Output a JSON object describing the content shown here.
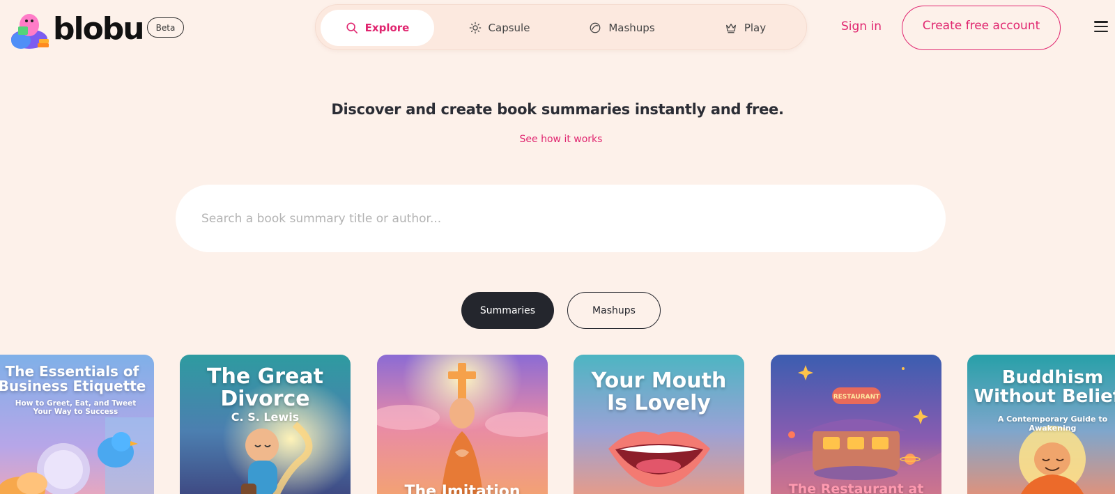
{
  "brand": {
    "name": "blobu",
    "badge": "Beta"
  },
  "nav": {
    "items": [
      {
        "label": "Explore",
        "icon": "search-icon",
        "active": true
      },
      {
        "label": "Capsule",
        "icon": "sun-icon",
        "active": false
      },
      {
        "label": "Mashups",
        "icon": "blend-icon",
        "active": false
      },
      {
        "label": "Play",
        "icon": "crown-icon",
        "active": false
      }
    ]
  },
  "header": {
    "signin": "Sign in",
    "create_account": "Create free account"
  },
  "hero": {
    "headline": "Discover and create book summaries instantly and free.",
    "how_link": "See how it works"
  },
  "search": {
    "placeholder": "Search a book summary title or author...",
    "value": ""
  },
  "filters": {
    "summaries": "Summaries",
    "mashups": "Mashups",
    "active": "Summaries"
  },
  "books": [
    {
      "title": "The Essentials of Business Etiquette",
      "subtitle": "How to Greet, Eat, and Tweet Your Way to Success"
    },
    {
      "title": "The Great Divorce",
      "author": "C. S. Lewis"
    },
    {
      "title": "The Imitation"
    },
    {
      "title": "Your Mouth Is Lovely"
    },
    {
      "title": "The Restaurant at",
      "sign": "RESTAURANT"
    },
    {
      "title": "Buddhism Without Beliefs",
      "subtitle": "A Contemporary Guide to Awakening"
    }
  ],
  "colors": {
    "accent": "#e0256f",
    "background": "#fdf1ea",
    "dark": "#24262d"
  }
}
